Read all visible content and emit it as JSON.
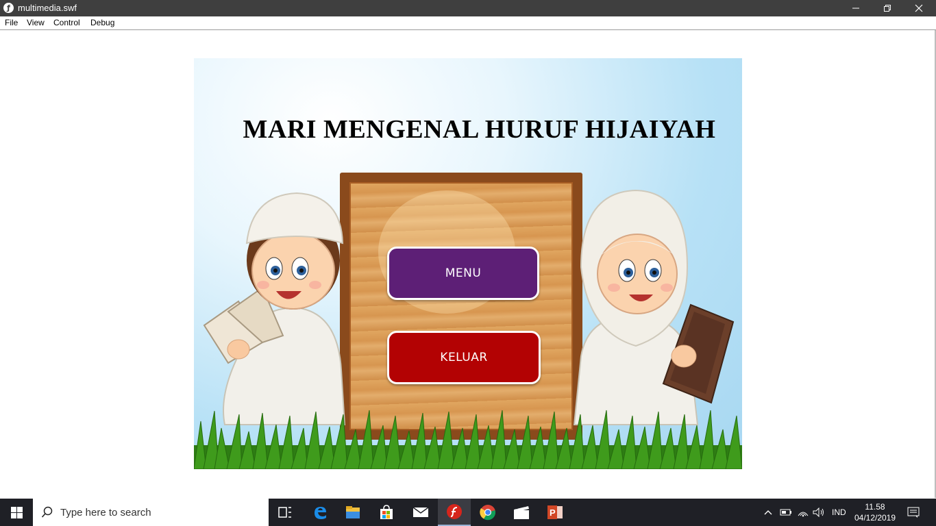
{
  "window": {
    "title": "multimedia.swf",
    "menu": [
      "File",
      "View",
      "Control",
      "Debug"
    ]
  },
  "stage": {
    "title": "MARI MENGENAL HURUF HIJAIYAH",
    "buttons": {
      "menu": "MENU",
      "exit": "KELUAR"
    }
  },
  "taskbar": {
    "search_placeholder": "Type here to search",
    "language": "IND",
    "time": "11.58",
    "date": "04/12/2019",
    "pinned_icons": [
      "task-view-icon",
      "edge-icon",
      "file-explorer-icon",
      "store-icon",
      "mail-icon",
      "flash-player-icon",
      "chrome-icon",
      "video-editor-icon",
      "powerpoint-icon"
    ]
  },
  "colors": {
    "menu_button": "#5d1f76",
    "exit_button": "#b30203",
    "titlebar": "#3f3f3f",
    "taskbar": "#1f2026"
  }
}
